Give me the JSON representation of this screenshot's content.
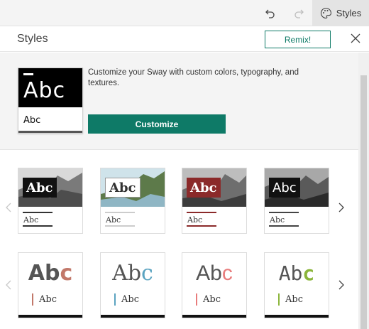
{
  "topbar": {
    "undo_icon": "undo-icon",
    "redo_icon": "redo-icon",
    "styles_icon": "palette-icon",
    "styles_label": "Styles"
  },
  "panel": {
    "title": "Styles",
    "remix_label": "Remix!",
    "close_icon": "close-icon"
  },
  "customize": {
    "preview_big": "Abc",
    "preview_small": "Abc",
    "description": "Customize your Sway with custom colors, typography, and textures.",
    "button_label": "Customize"
  },
  "photo_styles": [
    {
      "title": "Abc",
      "sub": "Abc",
      "accent": "#333333"
    },
    {
      "title": "Abc",
      "sub": "Abc",
      "accent": "#cccccc"
    },
    {
      "title": "Abc",
      "sub": "Abc",
      "accent": "#8b2a2a"
    },
    {
      "title": "Abc",
      "sub": "Abc",
      "accent": "#c46a8f"
    }
  ],
  "text_styles": [
    {
      "abc_main": "Ab",
      "abc_accent": "c",
      "sub": "Abc",
      "accent": "#c2786a"
    },
    {
      "abc_main": "Ab",
      "abc_accent": "c",
      "sub": "Abc",
      "accent": "#5aa3c0"
    },
    {
      "abc_main": "Ab",
      "abc_accent": "c",
      "sub": "Abc",
      "accent": "#e87c7c"
    },
    {
      "abc_main": "Ab",
      "abc_accent": "c",
      "sub": "Abc",
      "accent": "#8bb53b"
    }
  ],
  "colors": {
    "brand": "#0e7a67"
  }
}
